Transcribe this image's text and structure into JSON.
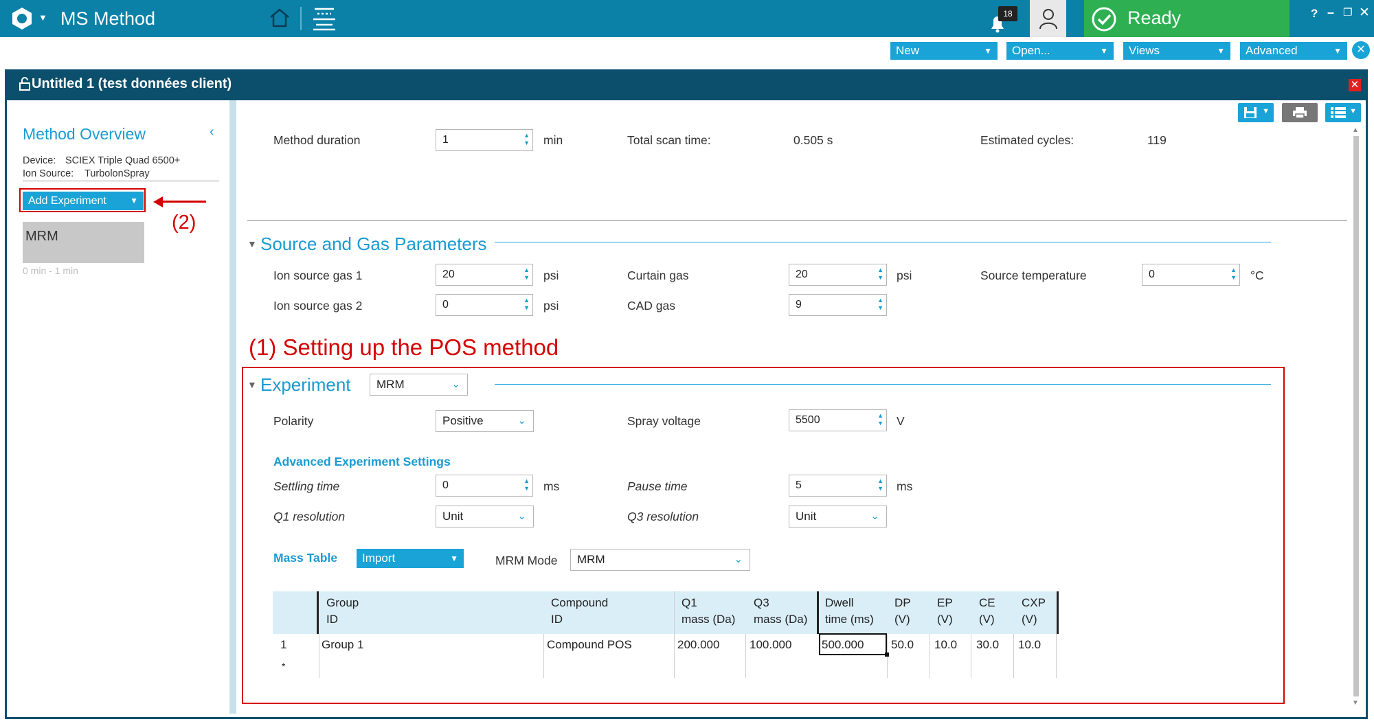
{
  "app": {
    "title": "MS Method",
    "notification_count": "18",
    "status": "Ready"
  },
  "toolbar": {
    "new": "New",
    "open": "Open...",
    "views": "Views",
    "advanced": "Advanced"
  },
  "window": {
    "title": "Untitled 1 (test données client)"
  },
  "left": {
    "overview_title": "Method Overview",
    "device_label": "Device:",
    "device_value": "SCIEX Triple Quad 6500+",
    "ion_label": "Ion Source:",
    "ion_value": "TurbolonSpray",
    "add_experiment": "Add Experiment",
    "annotation2": "(2)",
    "experiment_item": "MRM",
    "time_range": "0 min  -  1 min"
  },
  "method": {
    "duration_label": "Method duration",
    "duration_value": "1",
    "duration_unit": "min",
    "scan_label": "Total scan time:",
    "scan_value": "0.505 s",
    "cycles_label": "Estimated cycles:",
    "cycles_value": "119"
  },
  "source": {
    "title": "Source and Gas Parameters",
    "gas1_label": "Ion source gas 1",
    "gas1_value": "20",
    "gas1_unit": "psi",
    "curtain_label": "Curtain gas",
    "curtain_value": "20",
    "curtain_unit": "psi",
    "temp_label": "Source temperature",
    "temp_value": "0",
    "temp_unit": "°C",
    "gas2_label": "Ion source gas 2",
    "gas2_value": "0",
    "gas2_unit": "psi",
    "cad_label": "CAD gas",
    "cad_value": "9"
  },
  "annotation1": "(1) Setting up the POS method",
  "experiment": {
    "title": "Experiment",
    "type": "MRM",
    "polarity_label": "Polarity",
    "polarity_value": "Positive",
    "spray_label": "Spray voltage",
    "spray_value": "5500",
    "spray_unit": "V",
    "adv_title": "Advanced Experiment Settings",
    "settling_label": "Settling time",
    "settling_value": "0",
    "settling_unit": "ms",
    "pause_label": "Pause time",
    "pause_value": "5",
    "pause_unit": "ms",
    "q1res_label": "Q1 resolution",
    "q1res_value": "Unit",
    "q3res_label": "Q3 resolution",
    "q3res_value": "Unit"
  },
  "mass_table": {
    "title": "Mass Table",
    "import": "Import",
    "mode_label": "MRM Mode",
    "mode_value": "MRM",
    "headers": {
      "group_1": "Group",
      "group_2": "ID",
      "compound_1": "Compound",
      "compound_2": "ID",
      "q1_1": "Q1",
      "q1_2": "mass (Da)",
      "q3_1": "Q3",
      "q3_2": "mass (Da)",
      "dwell_1": "Dwell",
      "dwell_2": "time (ms)",
      "dp_1": "DP",
      "dp_2": "(V)",
      "ep_1": "EP",
      "ep_2": "(V)",
      "ce_1": "CE",
      "ce_2": "(V)",
      "cxp_1": "CXP",
      "cxp_2": "(V)"
    },
    "rows": [
      {
        "index": "1",
        "group": "Group 1",
        "compound": "Compound POS",
        "q1": "200.000",
        "q3": "100.000",
        "dwell": "500.000",
        "dp": "50.0",
        "ep": "10.0",
        "ce": "30.0",
        "cxp": "10.0"
      }
    ],
    "new_row_marker": "*"
  },
  "colors": {
    "accent": "#1aa3d6",
    "header_bg": "#0b81a8",
    "window_bar": "#0b4f6c",
    "ready_green": "#2eb052",
    "annotation_red": "#d40000"
  }
}
